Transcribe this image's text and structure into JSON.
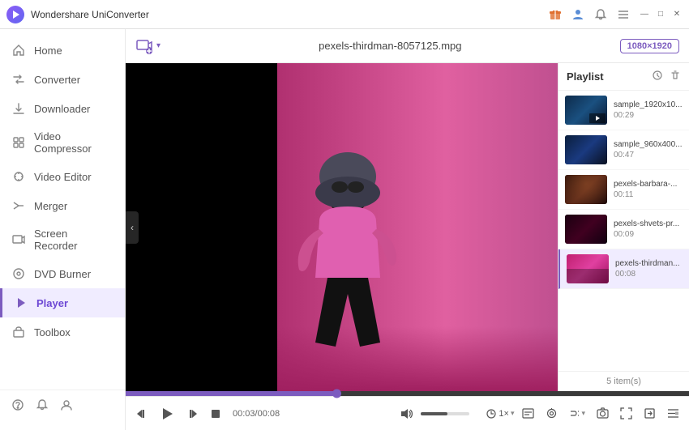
{
  "app": {
    "title": "Wondershare UniConverter",
    "logo_symbol": "▶"
  },
  "titlebar": {
    "title": "Wondershare UniConverter",
    "icons": [
      "gift",
      "person",
      "bell",
      "menu"
    ],
    "controls": [
      "—",
      "□",
      "✕"
    ]
  },
  "sidebar": {
    "items": [
      {
        "id": "home",
        "label": "Home",
        "icon": "⌂"
      },
      {
        "id": "converter",
        "label": "Converter",
        "icon": "⇄"
      },
      {
        "id": "downloader",
        "label": "Downloader",
        "icon": "↓"
      },
      {
        "id": "video-compressor",
        "label": "Video Compressor",
        "icon": "⊞"
      },
      {
        "id": "video-editor",
        "label": "Video Editor",
        "icon": "✂"
      },
      {
        "id": "merger",
        "label": "Merger",
        "icon": "⊕"
      },
      {
        "id": "screen-recorder",
        "label": "Screen Recorder",
        "icon": "▣"
      },
      {
        "id": "dvd-burner",
        "label": "DVD Burner",
        "icon": "◎"
      },
      {
        "id": "player",
        "label": "Player",
        "icon": "▶",
        "active": true
      },
      {
        "id": "toolbox",
        "label": "Toolbox",
        "icon": "⚙"
      }
    ],
    "footer_icons": [
      "?",
      "🔔",
      "☺"
    ]
  },
  "toolbar": {
    "add_label": "📂",
    "filename": "pexels-thirdman-8057125.mpg",
    "resolution": "1080×1920"
  },
  "playlist": {
    "title": "Playlist",
    "item_count_label": "5 item(s)",
    "items": [
      {
        "name": "sample_1920x10...",
        "duration": "00:29",
        "thumb_class": "thumb-1"
      },
      {
        "name": "sample_960x400...",
        "duration": "00:47",
        "thumb_class": "thumb-2"
      },
      {
        "name": "pexels-barbara-...",
        "duration": "00:11",
        "thumb_class": "thumb-3"
      },
      {
        "name": "pexels-shvets-pr...",
        "duration": "00:09",
        "thumb_class": "thumb-4"
      },
      {
        "name": "pexels-thirdman...",
        "duration": "00:08",
        "thumb_class": "thumb-5",
        "active": true
      }
    ]
  },
  "player": {
    "current_time": "00:03",
    "total_time": "00:08",
    "time_display": "00:03/00:08",
    "seek_percent": 37.5,
    "volume_percent": 55
  },
  "controls": {
    "rewind": "⏮",
    "play": "▶",
    "forward": "⏭",
    "stop": "■",
    "volume_icon": "🔊",
    "speed": "1×",
    "caption": "⊟",
    "audio": "🎵",
    "snapshot": "📷",
    "fullscreen": "⛶",
    "playlist_toggle": "☰"
  }
}
